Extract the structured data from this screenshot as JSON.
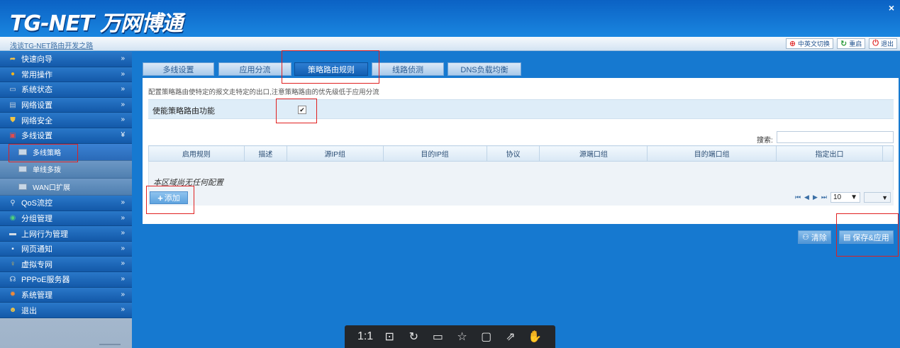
{
  "header": {
    "logo_text": "TG-NET 万网博通",
    "close_label": "×"
  },
  "subbar": {
    "slogan": "浅谈TG-NET路由开发之路",
    "buttons": [
      {
        "label": "中英文切换",
        "icon": "language-icon"
      },
      {
        "label": "重启",
        "icon": "restart-icon"
      },
      {
        "label": "退出",
        "icon": "exit-icon"
      }
    ]
  },
  "sidebar": {
    "items": [
      {
        "label": "快速向导",
        "icon": "wizard-icon",
        "arrow": "»"
      },
      {
        "label": "常用操作",
        "icon": "common-ops-icon",
        "arrow": "»"
      },
      {
        "label": "系统状态",
        "icon": "system-status-icon",
        "arrow": "»"
      },
      {
        "label": "网络设置",
        "icon": "network-settings-icon",
        "arrow": "»"
      },
      {
        "label": "网络安全",
        "icon": "security-icon",
        "arrow": "»"
      },
      {
        "label": "多线设置",
        "icon": "multiline-icon",
        "arrow": "¥"
      }
    ],
    "subitems": [
      {
        "label": "多线策略"
      },
      {
        "label": "单线多拨"
      },
      {
        "label": "WAN口扩展"
      }
    ],
    "items_after": [
      {
        "label": "QoS流控",
        "icon": "qos-icon",
        "arrow": "»"
      },
      {
        "label": "分组管理",
        "icon": "group-icon",
        "arrow": "»"
      },
      {
        "label": "上网行为管理",
        "icon": "behavior-icon",
        "arrow": "»"
      },
      {
        "label": "网页通知",
        "icon": "notice-icon",
        "arrow": "»"
      },
      {
        "label": "虚拟专网",
        "icon": "vpn-icon",
        "arrow": "»"
      },
      {
        "label": "PPPoE服务器",
        "icon": "pppoe-icon",
        "arrow": "»"
      },
      {
        "label": "系统管理",
        "icon": "system-admin-icon",
        "arrow": "»"
      },
      {
        "label": "退出",
        "icon": "logout-icon",
        "arrow": "»"
      }
    ]
  },
  "tabs": [
    "多线设置",
    "应用分流",
    "策略路由规则",
    "线路侦测",
    "DNS负载均衡"
  ],
  "main": {
    "description": "配置策略路由使特定的报文走特定的出口,注意策略路由的优先级低于应用分流",
    "enable_label": "使能策略路由功能",
    "enable_checked": true,
    "checkbox_mark": "✔",
    "search_label": "搜索:",
    "columns": [
      "启用规则",
      "描述",
      "源IP组",
      "目的IP组",
      "协议",
      "源端口组",
      "目的端口组",
      "指定出口"
    ],
    "empty_text": "本区域尚无任何配置",
    "add_label": "添加",
    "page_size": "10",
    "page_size_arrow": "▼",
    "page_select_arrow": "▼",
    "pager_first": "⏮",
    "pager_prev": "◀",
    "pager_next": "▶",
    "pager_last": "⏭"
  },
  "actions": {
    "clear_label": "清除",
    "save_label": "保存&应用"
  },
  "viewer": {
    "ratio_label": "1:1"
  }
}
